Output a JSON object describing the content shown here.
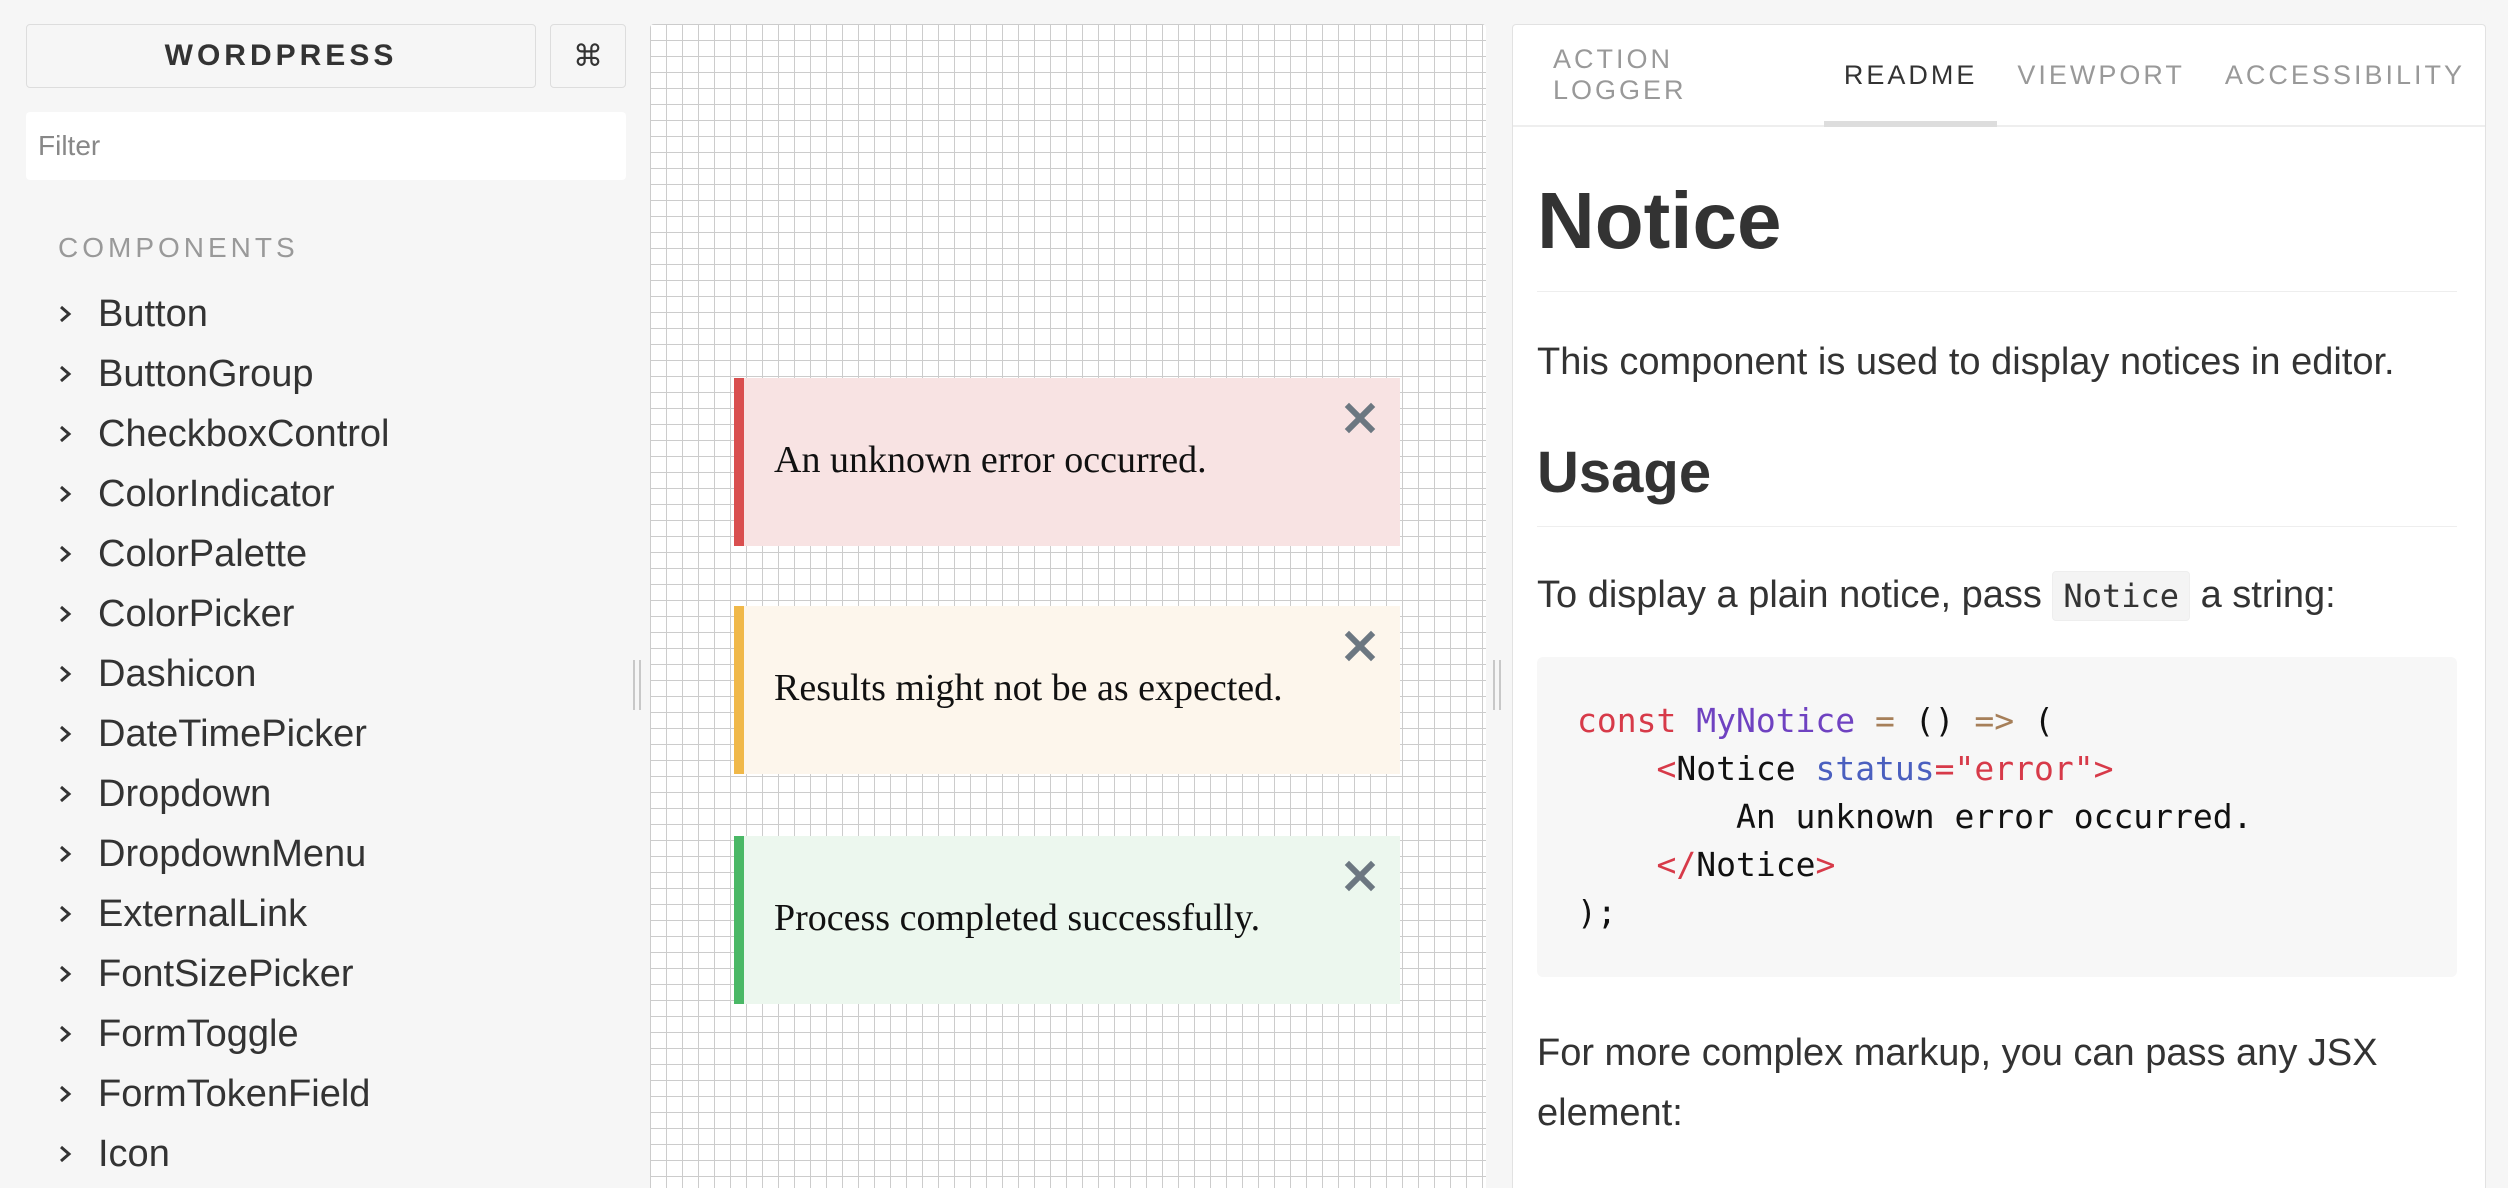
{
  "sidebar": {
    "brand": "WORDPRESS",
    "shortcut_icon": "⌘",
    "filter_placeholder": "Filter",
    "section_title": "COMPONENTS",
    "items": [
      "Button",
      "ButtonGroup",
      "CheckboxControl",
      "ColorIndicator",
      "ColorPalette",
      "ColorPicker",
      "Dashicon",
      "DateTimePicker",
      "Dropdown",
      "DropdownMenu",
      "ExternalLink",
      "FontSizePicker",
      "FormToggle",
      "FormTokenField",
      "Icon"
    ]
  },
  "preview": {
    "notices": [
      {
        "status": "error",
        "message": "An unknown error occurred.",
        "accent": "#d94f4f",
        "background": "#f8e3e3"
      },
      {
        "status": "warning",
        "message": "Results might not be as expected.",
        "accent": "#f0b849",
        "background": "#fdf6ec"
      },
      {
        "status": "success",
        "message": "Process completed successfully.",
        "accent": "#4ab866",
        "background": "#ecf7ee"
      }
    ],
    "close_icon": "close-icon"
  },
  "panel": {
    "tabs": [
      {
        "label": "ACTION LOGGER",
        "active": false
      },
      {
        "label": "README",
        "active": true
      },
      {
        "label": "VIEWPORT",
        "active": false
      },
      {
        "label": "ACCESSIBILITY",
        "active": false
      }
    ],
    "readme": {
      "title": "Notice",
      "intro": "This component is used to display notices in editor.",
      "usage_heading": "Usage",
      "usage_text_before": "To display a plain notice, pass ",
      "usage_code": "Notice",
      "usage_text_after": " a string:",
      "code": {
        "kw_const": "const",
        "fn_name": "MyNotice",
        "op_eq": "=",
        "parens": "()",
        "op_arrow": "=>",
        "open_paren": "(",
        "tag_open_lt": "<",
        "tag_name": "Notice",
        "attr_name": "status",
        "attr_eq_value": "=\"error\">",
        "inner_text": "An unknown error occurred.",
        "tag_close_lt": "</",
        "tag_close_name": "Notice",
        "tag_close_gt": ">",
        "closing": ");"
      },
      "more_text": "For more complex markup, you can pass any JSX element:"
    }
  }
}
